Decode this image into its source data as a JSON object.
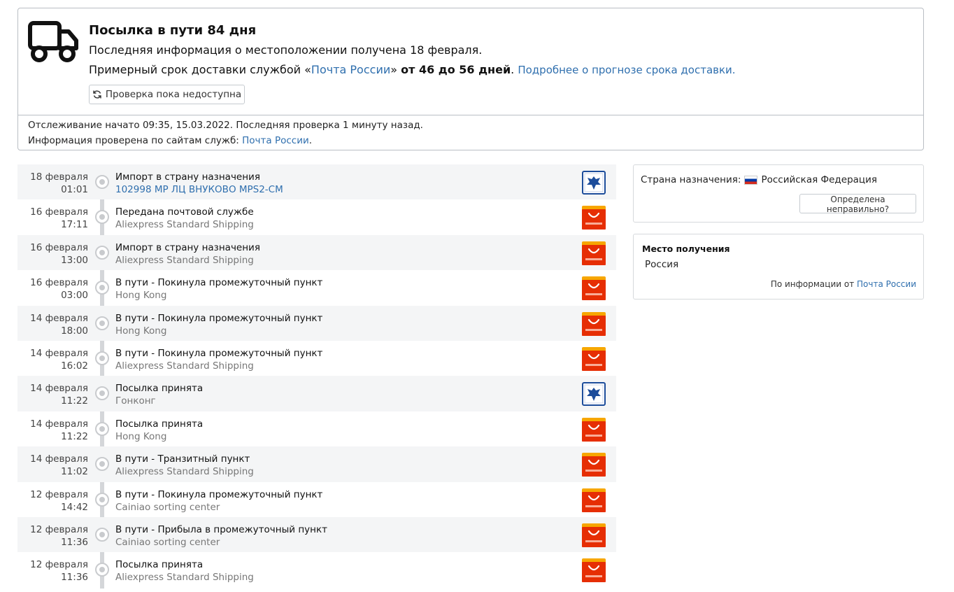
{
  "status": {
    "title": "Посылка в пути 84 дня",
    "location_text": "Последняя информация о местоположении получена 18 февраля.",
    "estimate_prefix": "Примерный срок доставки службой «",
    "carrier_link": "Почта России",
    "estimate_quote_close": "»",
    "estimate_range": "от 46 до 56 дней",
    "estimate_period": ".",
    "forecast_link": "Подробнее о прогнозе срока доставки.",
    "check_button": "Проверка пока недоступна",
    "tracking_started": "Отслеживание начато 09:35, 15.03.2022. Последняя проверка 1 минуту назад.",
    "checked_prefix": "Информация проверена по сайтам служб: ",
    "checked_link": "Почта России",
    "checked_suffix": "."
  },
  "events": [
    {
      "date": "18 февраля",
      "time": "01:01",
      "title": "Импорт в страну назначения",
      "subtitle": "102998 MP ЛЦ ВНУКОВО MPS2-CM",
      "sub_link": true,
      "logo": "russian-post-logo-icon"
    },
    {
      "date": "16 февраля",
      "time": "17:11",
      "title": "Передана почтовой службе",
      "subtitle": "Aliexpress Standard Shipping",
      "sub_link": false,
      "logo": "aliexpress-logo-icon"
    },
    {
      "date": "16 февраля",
      "time": "13:00",
      "title": "Импорт в страну назначения",
      "subtitle": "Aliexpress Standard Shipping",
      "sub_link": false,
      "logo": "aliexpress-logo-icon"
    },
    {
      "date": "16 февраля",
      "time": "03:00",
      "title": "В пути - Покинула промежуточный пункт",
      "subtitle": "Hong Kong",
      "sub_link": false,
      "logo": "aliexpress-logo-icon"
    },
    {
      "date": "14 февраля",
      "time": "18:00",
      "title": "В пути - Покинула промежуточный пункт",
      "subtitle": "Hong Kong",
      "sub_link": false,
      "logo": "aliexpress-logo-icon"
    },
    {
      "date": "14 февраля",
      "time": "16:02",
      "title": "В пути - Покинула промежуточный пункт",
      "subtitle": "Aliexpress Standard Shipping",
      "sub_link": false,
      "logo": "aliexpress-logo-icon"
    },
    {
      "date": "14 февраля",
      "time": "11:22",
      "title": "Посылка принята",
      "subtitle": "Гонконг",
      "sub_link": false,
      "logo": "russian-post-logo-icon"
    },
    {
      "date": "14 февраля",
      "time": "11:22",
      "title": "Посылка принята",
      "subtitle": "Hong Kong",
      "sub_link": false,
      "logo": "aliexpress-logo-icon"
    },
    {
      "date": "14 февраля",
      "time": "11:02",
      "title": "В пути - Транзитный пункт",
      "subtitle": "Aliexpress Standard Shipping",
      "sub_link": false,
      "logo": "aliexpress-logo-icon"
    },
    {
      "date": "12 февраля",
      "time": "14:42",
      "title": "В пути - Покинула промежуточный пункт",
      "subtitle": "Cainiao sorting center",
      "sub_link": false,
      "logo": "aliexpress-logo-icon"
    },
    {
      "date": "12 февраля",
      "time": "11:36",
      "title": "В пути - Прибыла в промежуточный пункт",
      "subtitle": "Cainiao sorting center",
      "sub_link": false,
      "logo": "aliexpress-logo-icon"
    },
    {
      "date": "12 февраля",
      "time": "11:36",
      "title": "Посылка принята",
      "subtitle": "Aliexpress Standard Shipping",
      "sub_link": false,
      "logo": "aliexpress-logo-icon"
    }
  ],
  "destination": {
    "label": "Страна назначения:",
    "country": "Российская Федерация",
    "wrong_button": "Определена неправильно?"
  },
  "pickup": {
    "title": "Место получения",
    "value": "Россия",
    "source_prefix": "По информации от ",
    "source_link": "Почта России"
  },
  "colors": {
    "link": "#2f6fae",
    "aliexpress_red": "#e62e04",
    "aliexpress_orange": "#f7a600",
    "russian_post_blue": "#1d4d9b"
  }
}
